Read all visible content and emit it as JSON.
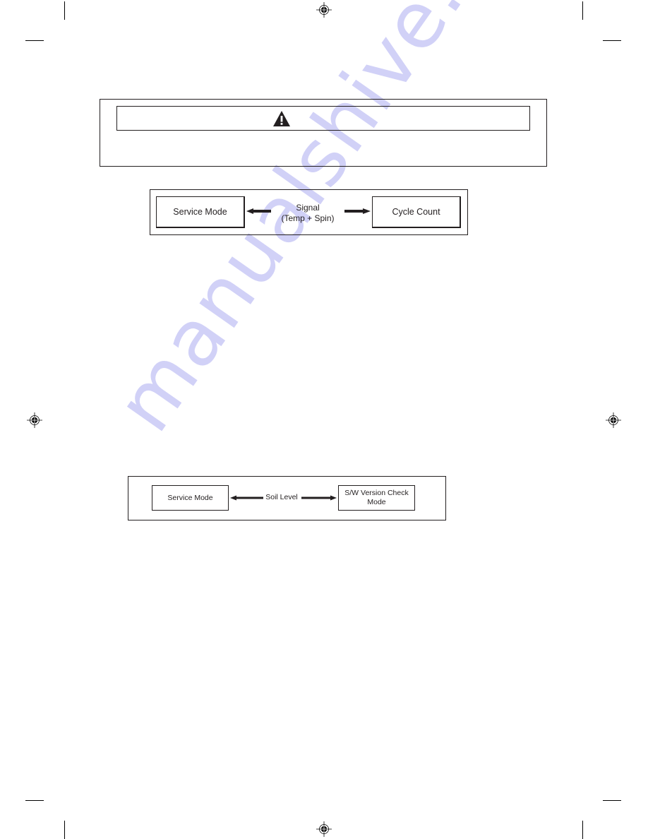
{
  "page": {
    "warning_box": {
      "header_icon": "warning-triangle-icon",
      "header_text": "",
      "body_text": ""
    },
    "diagram_1": {
      "left_node": "Service Mode",
      "connector_label_line1": "Signal",
      "connector_label_line2": "(Temp + Spin)",
      "right_node": "Cycle Count",
      "left_arrow_icon": "arrow-left-icon",
      "right_arrow_icon": "arrow-right-icon"
    },
    "diagram_2": {
      "left_node": "Service Mode",
      "connector_label": "Soil Level",
      "right_node_line1": "S/W Version Check",
      "right_node_line2": "Mode",
      "left_arrow_icon": "arrow-left-icon",
      "right_arrow_icon": "arrow-right-icon"
    },
    "print_marks": {
      "registration_icon": "registration-mark-icon",
      "crop_mark": "crop-mark"
    },
    "watermark": "manualshive.com",
    "colors": {
      "ink": "#231f20",
      "watermark": "#c9c9f6"
    }
  }
}
